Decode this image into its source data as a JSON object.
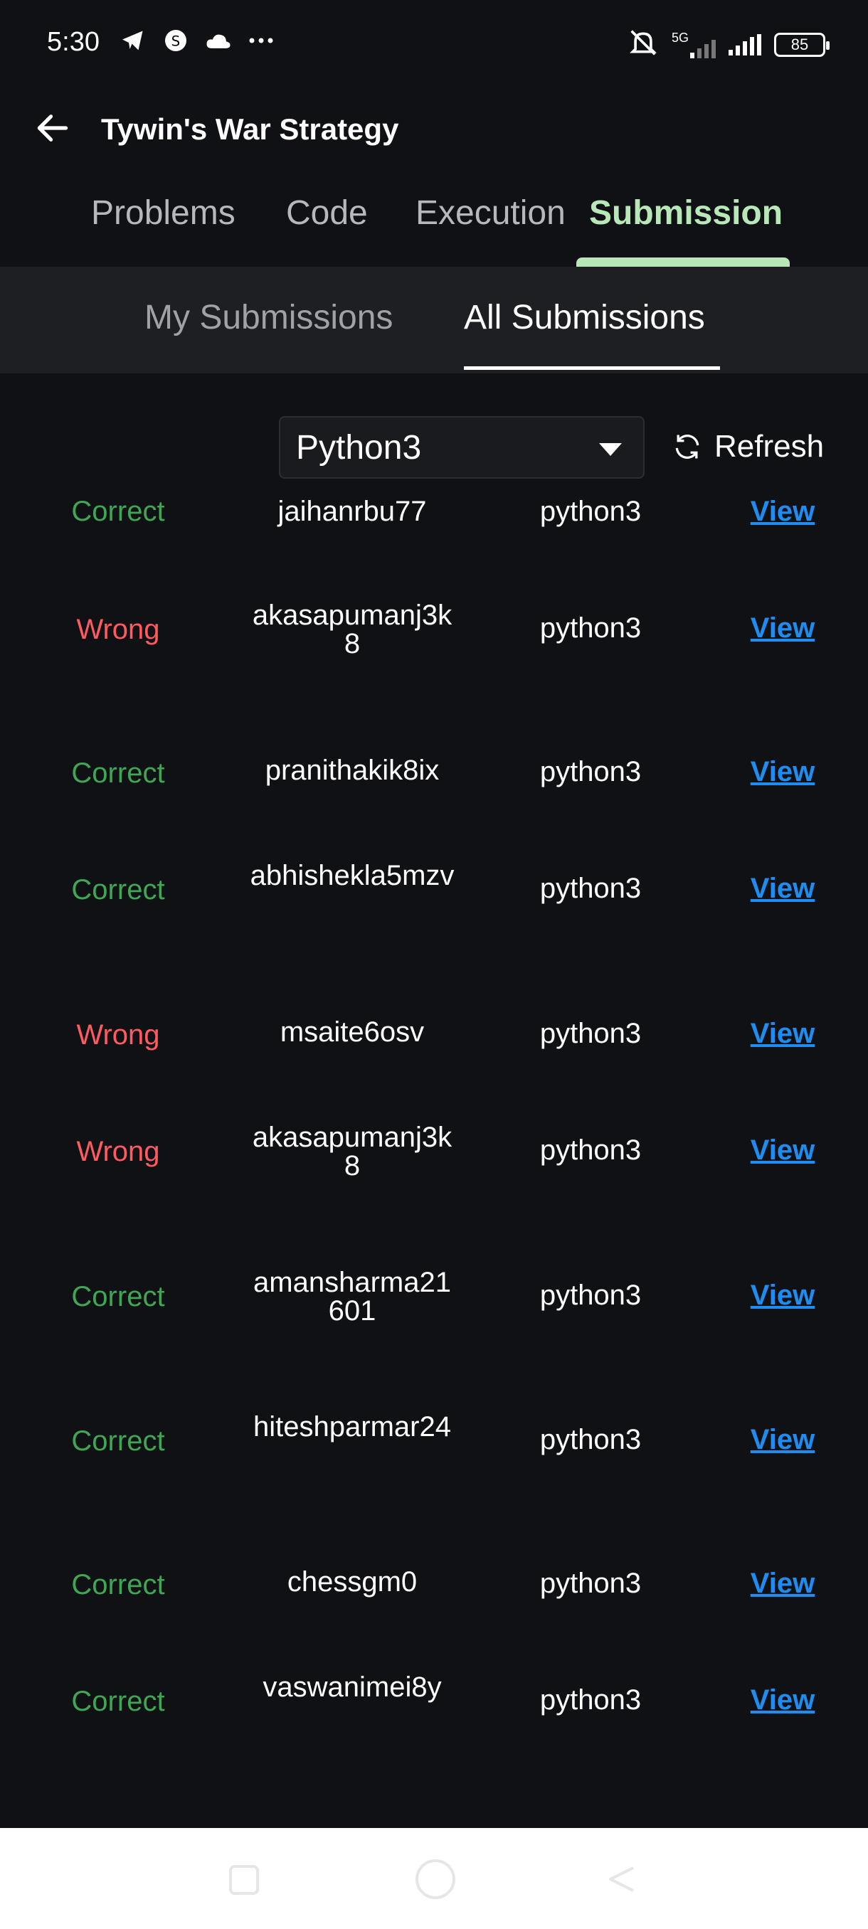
{
  "status_bar": {
    "time": "5:30",
    "network": "5G",
    "battery": "85"
  },
  "header": {
    "title": "Tywin's War Strategy"
  },
  "main_tabs": [
    {
      "label": "Problems"
    },
    {
      "label": "Code"
    },
    {
      "label": "Execution"
    },
    {
      "label": "Submission"
    }
  ],
  "sub_tabs": [
    {
      "label": "My Submissions"
    },
    {
      "label": "All Submissions"
    }
  ],
  "filter": {
    "language": "Python3",
    "refresh_label": "Refresh"
  },
  "submissions": [
    {
      "status": "Correct",
      "user": "jaihanrbu77",
      "lang": "python3",
      "action": "View"
    },
    {
      "status": "Wrong",
      "user": "akasapumanj3k8",
      "lang": "python3",
      "action": "View"
    },
    {
      "status": "Correct",
      "user": "pranithakik8ix",
      "lang": "python3",
      "action": "View"
    },
    {
      "status": "Correct",
      "user": "abhishekla5mzv",
      "lang": "python3",
      "action": "View"
    },
    {
      "status": "Wrong",
      "user": "msaite6osv",
      "lang": "python3",
      "action": "View"
    },
    {
      "status": "Wrong",
      "user": "akasapumanj3k8",
      "lang": "python3",
      "action": "View"
    },
    {
      "status": "Correct",
      "user": "amansharma21601",
      "lang": "python3",
      "action": "View"
    },
    {
      "status": "Correct",
      "user": "hiteshparmar24",
      "lang": "python3",
      "action": "View"
    },
    {
      "status": "Correct",
      "user": "chessgm0",
      "lang": "python3",
      "action": "View"
    },
    {
      "status": "Correct",
      "user": "vaswanimei8y",
      "lang": "python3",
      "action": "View"
    }
  ],
  "colors": {
    "correct": "#3fa653",
    "wrong": "#ff5a5f",
    "link": "#1e8cf0",
    "accent_tab": "#b8e8b8"
  }
}
